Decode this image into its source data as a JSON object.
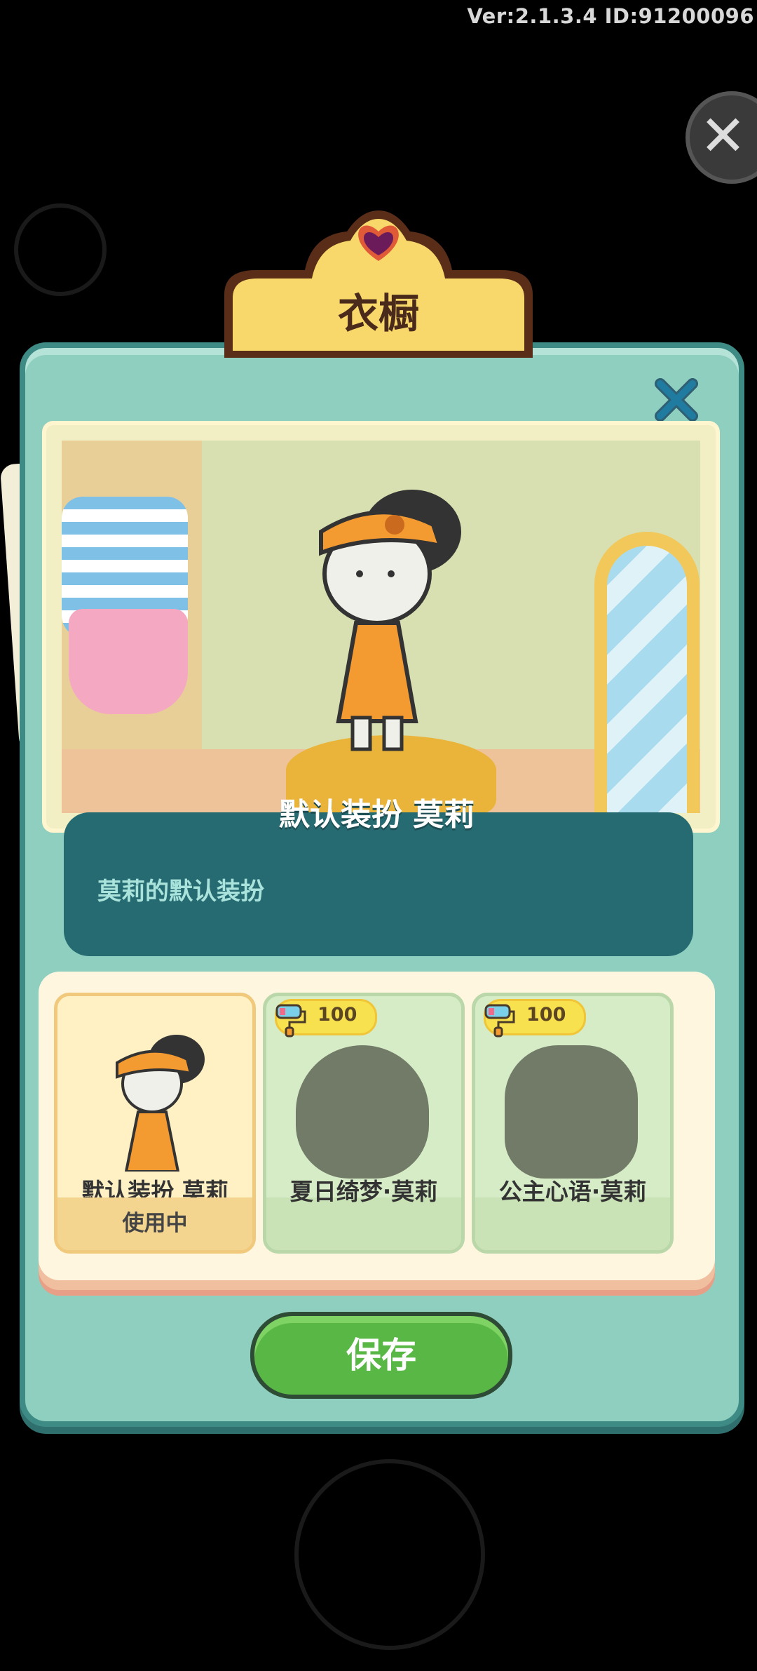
{
  "version_text": "Ver:2.1.3.4 ID:91200096",
  "dialog": {
    "title": "衣橱",
    "preview": {
      "outfit_title": "默认装扮 莫莉",
      "description": "莫莉的默认装扮"
    },
    "outfits": [
      {
        "name": "默认装扮 莫莉",
        "status": "使用中",
        "locked": false
      },
      {
        "name": "夏日绮梦·莫莉",
        "price": "100",
        "locked": true
      },
      {
        "name": "公主心语·莫莉",
        "price": "100",
        "locked": true
      }
    ],
    "save_label": "保存"
  },
  "colors": {
    "panel": "#8ecfc0",
    "accent_green": "#59b745",
    "desc_box": "#266b72",
    "banner_yellow": "#f8d86b"
  }
}
